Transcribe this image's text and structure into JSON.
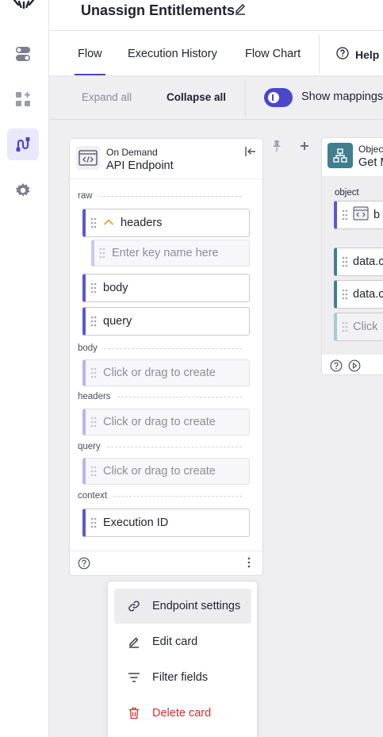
{
  "header": {
    "title": "Unassign Entitlements",
    "edit_icon": "pencil-icon"
  },
  "tabs": {
    "items": [
      "Flow",
      "Execution History",
      "Flow Chart"
    ],
    "active": "Flow",
    "help_label": "Help"
  },
  "toolbar": {
    "expand_all": "Expand all",
    "collapse_all": "Collapse all",
    "show_mappings": "Show mappings",
    "show_mappings_on": true
  },
  "card": {
    "subtitle": "On Demand",
    "title": "API Endpoint",
    "sections": {
      "raw": "raw",
      "body": "body",
      "headers": "headers",
      "query": "query",
      "context": "context"
    },
    "fields": {
      "headers": "headers",
      "headers_key_placeholder": "Enter key name here",
      "body": "body",
      "query": "query",
      "body_create": "Click or drag to create",
      "headers_create": "Click or drag to create",
      "query_create": "Click or drag to create",
      "execution_id": "Execution ID"
    }
  },
  "card2": {
    "subtitle": "Objec",
    "title": "Get M",
    "object_label": "object",
    "field1": "b",
    "field2": "data.c",
    "field3": "data.c",
    "field4": "Click"
  },
  "menu": {
    "items": [
      {
        "label": "Endpoint settings",
        "icon": "link-icon"
      },
      {
        "label": "Edit card",
        "icon": "pencil-icon"
      },
      {
        "label": "Filter fields",
        "icon": "filter-icon"
      },
      {
        "label": "Delete card",
        "icon": "trash-icon"
      }
    ]
  },
  "colors": {
    "accent": "#4a47c9",
    "field_border": "#5a57d6",
    "teal": "#3f7f90",
    "danger": "#d2322d",
    "canvas": "#efeff2"
  }
}
